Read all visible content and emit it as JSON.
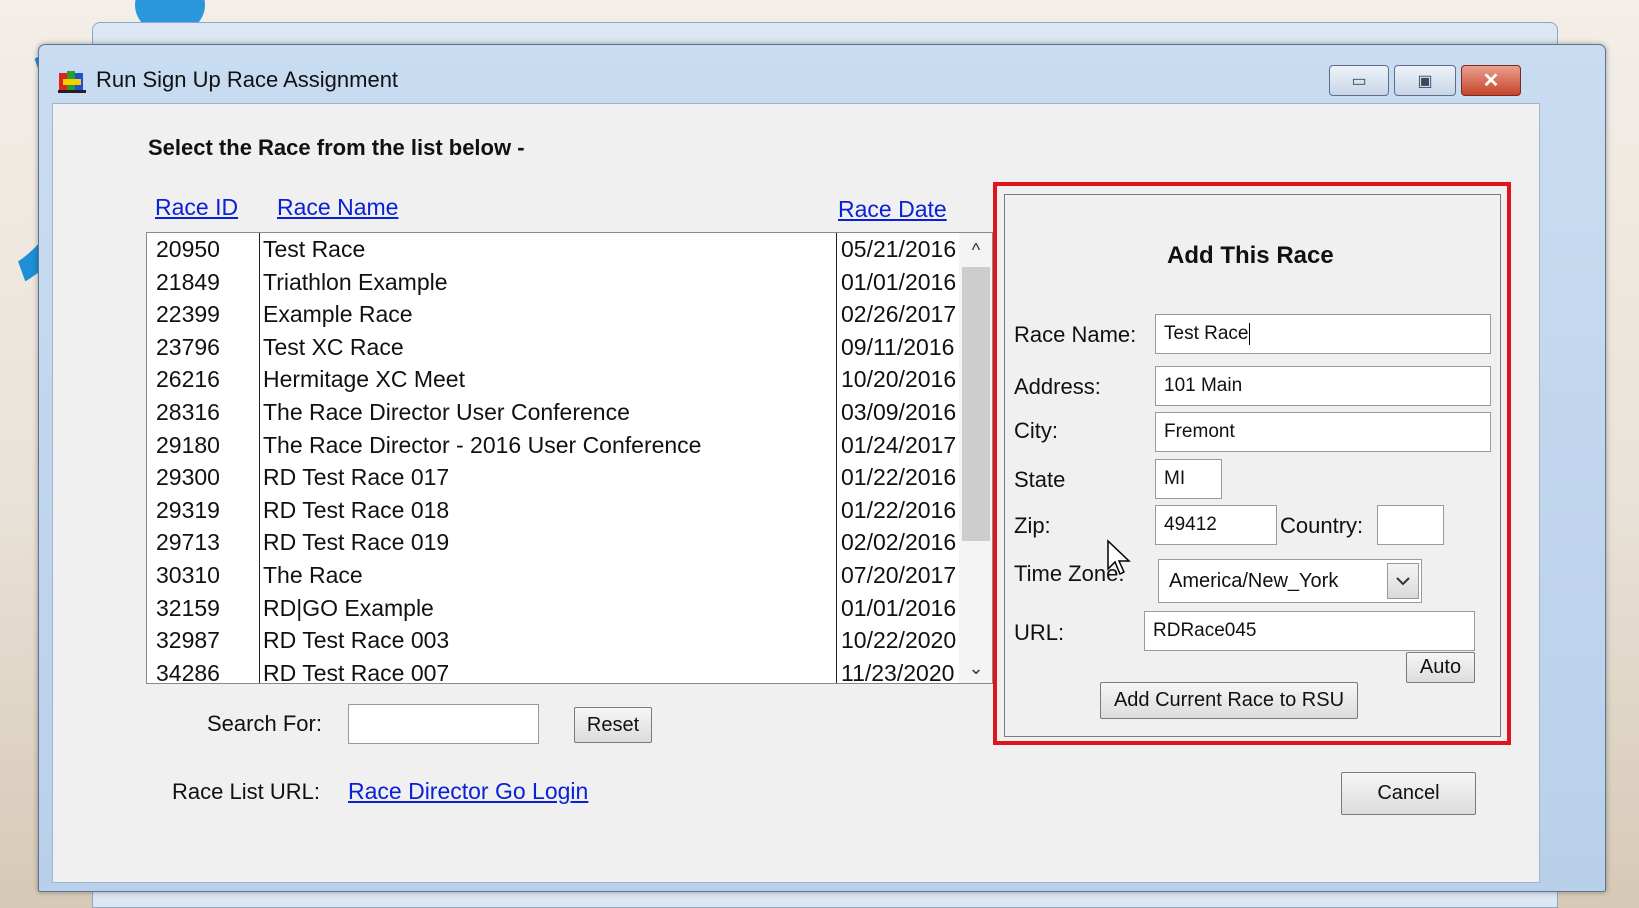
{
  "window": {
    "title": "Run Sign Up Race Assignment",
    "minimize_glyph": "▭",
    "maximize_glyph": "▣",
    "close_glyph": "✕"
  },
  "instruction": "Select the Race from the list below -",
  "columns": {
    "race_id": "Race ID",
    "race_name": "Race Name",
    "race_date": "Race Date"
  },
  "races": [
    {
      "id": "20950",
      "name": "Test Race",
      "date": "05/21/2016"
    },
    {
      "id": "21849",
      "name": "Triathlon Example",
      "date": "01/01/2016"
    },
    {
      "id": "22399",
      "name": "Example Race",
      "date": "02/26/2017"
    },
    {
      "id": "23796",
      "name": "Test XC Race",
      "date": "09/11/2016"
    },
    {
      "id": "26216",
      "name": "Hermitage XC Meet",
      "date": "10/20/2016"
    },
    {
      "id": "28316",
      "name": "The Race Director User Conference",
      "date": "03/09/2016"
    },
    {
      "id": "29180",
      "name": "The Race Director - 2016 User Conference",
      "date": "01/24/2017"
    },
    {
      "id": "29300",
      "name": "RD Test Race 017",
      "date": "01/22/2016"
    },
    {
      "id": "29319",
      "name": "RD Test Race 018",
      "date": "01/22/2016"
    },
    {
      "id": "29713",
      "name": "RD Test Race 019",
      "date": "02/02/2016"
    },
    {
      "id": "30310",
      "name": "The Race",
      "date": "07/20/2017"
    },
    {
      "id": "32159",
      "name": "RD|GO Example",
      "date": "01/01/2016"
    },
    {
      "id": "32987",
      "name": "RD Test Race 003",
      "date": "10/22/2020"
    },
    {
      "id": "34286",
      "name": "RD Test Race 007",
      "date": "11/23/2020"
    }
  ],
  "scroll": {
    "up_glyph": "^",
    "down_glyph": "⌄"
  },
  "search": {
    "label": "Search For:",
    "value": "",
    "reset_label": "Reset"
  },
  "race_list_url": {
    "label": "Race List URL:",
    "link_text": "Race Director Go Login"
  },
  "add_race": {
    "title": "Add This Race",
    "race_name_label": "Race Name:",
    "race_name_value": "Test Race",
    "address_label": "Address:",
    "address_value": "101 Main",
    "city_label": "City:",
    "city_value": "Fremont",
    "state_label": "State",
    "state_value": "MI",
    "zip_label": "Zip:",
    "zip_value": "49412",
    "country_label": "Country:",
    "country_value": "",
    "timezone_label": "Time Zone:",
    "timezone_value": "America/New_York",
    "url_label": "URL:",
    "url_value": "RDRace045",
    "auto_label": "Auto",
    "add_button_label": "Add Current Race to RSU"
  },
  "cancel_label": "Cancel",
  "colors": {
    "highlight": "#e0141b",
    "link": "#0a21d8"
  }
}
